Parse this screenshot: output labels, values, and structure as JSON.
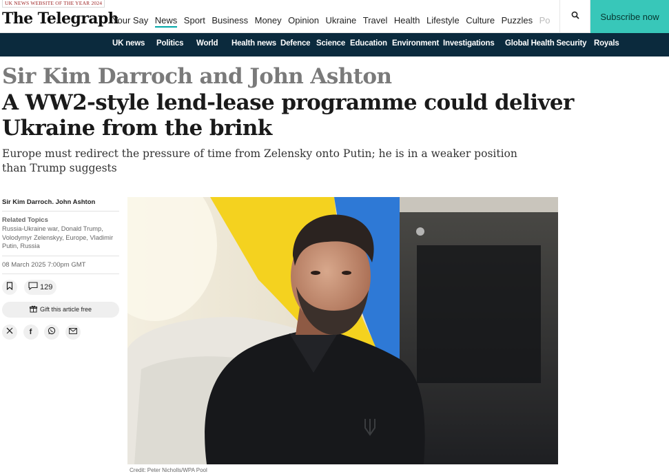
{
  "header": {
    "award_banner": "UK NEWS WEBSITE OF THE YEAR 2024",
    "masthead": "The Telegraph",
    "primary_nav": [
      "Your Say",
      "News",
      "Sport",
      "Business",
      "Money",
      "Opinion",
      "Ukraine",
      "Travel",
      "Health",
      "Lifestyle",
      "Culture",
      "Puzzles",
      "Po"
    ],
    "active_item": "News",
    "subscribe_label": "Subscribe now",
    "accent_color": "#38c7b9"
  },
  "secondary_nav": [
    "UK news",
    "Politics",
    "World",
    "Health news",
    "Defence",
    "Science",
    "Education",
    "Environment",
    "Investigations",
    "Global Health Security",
    "Royals"
  ],
  "article": {
    "authors_title": "Sir Kim Darroch and John Ashton",
    "headline": "A WW2-style lend-lease programme could deliver Ukraine from the brink",
    "standfirst": "Europe must redirect the pressure of time from Zelensky onto Putin; he is in a weaker position than Trump suggests",
    "byline": "Sir Kim Darroch. John Ashton",
    "related_heading": "Related Topics",
    "related_topics": "Russia-Ukraine war, Donald Trump, Volodymyr Zelenskyy, Europe, Vladimir Putin, Russia",
    "date": "08 March 2025 7:00pm GMT",
    "comment_count": "129",
    "gift_label": "Gift this article free",
    "share_icons": [
      "x-icon",
      "facebook-icon",
      "whatsapp-icon",
      "email-icon"
    ],
    "photo_credit": "Credit: Peter Nicholls/WPA Pool"
  }
}
